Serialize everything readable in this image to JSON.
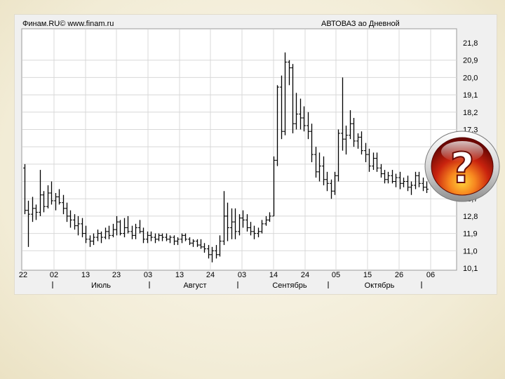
{
  "chart_data": {
    "type": "ohlc",
    "header_left": "Финам.RU© www.finam.ru",
    "title": "АВТОВАЗ ао Дневной",
    "yticks": [
      "21,8",
      "20,9",
      "20,0",
      "19,1",
      "18,2",
      "17,3",
      "16,4",
      "15,5",
      "14,6",
      "13,7",
      "12,8",
      "11,9",
      "11,0",
      "10,1"
    ],
    "ylim": [
      10.1,
      21.8
    ],
    "day_ticks": [
      "22",
      "02",
      "13",
      "23",
      "03",
      "13",
      "24",
      "03",
      "14",
      "24",
      "05",
      "15",
      "26",
      "06"
    ],
    "months": [
      "Июль",
      "Август",
      "Сентябрь",
      "Октябрь"
    ],
    "grid": true,
    "bars": [
      [
        15.3,
        15.5,
        12.9,
        13.1
      ],
      [
        13.1,
        13.6,
        11.2,
        12.9
      ],
      [
        12.9,
        13.8,
        12.5,
        13.2
      ],
      [
        13.2,
        13.4,
        12.6,
        13.0
      ],
      [
        13.0,
        15.2,
        12.8,
        13.9
      ],
      [
        13.9,
        14.1,
        13.0,
        13.3
      ],
      [
        13.3,
        14.4,
        13.2,
        14.0
      ],
      [
        14.0,
        14.6,
        13.4,
        13.6
      ],
      [
        13.6,
        14.0,
        13.1,
        13.8
      ],
      [
        13.8,
        14.2,
        13.4,
        13.5
      ],
      [
        13.5,
        13.9,
        12.9,
        13.2
      ],
      [
        13.2,
        13.5,
        12.5,
        12.8
      ],
      [
        12.8,
        13.1,
        12.2,
        12.6
      ],
      [
        12.6,
        12.9,
        12.1,
        12.3
      ],
      [
        12.3,
        12.8,
        11.8,
        12.4
      ],
      [
        12.4,
        12.7,
        11.7,
        11.9
      ],
      [
        11.9,
        12.3,
        11.4,
        11.6
      ],
      [
        11.6,
        11.8,
        11.2,
        11.5
      ],
      [
        11.5,
        11.9,
        11.3,
        11.7
      ],
      [
        11.7,
        12.1,
        11.5,
        11.9
      ],
      [
        11.9,
        12.0,
        11.4,
        11.7
      ],
      [
        11.7,
        12.2,
        11.6,
        12.0
      ],
      [
        12.0,
        12.3,
        11.6,
        11.8
      ],
      [
        11.8,
        12.4,
        11.7,
        12.1
      ],
      [
        12.1,
        12.8,
        11.8,
        12.5
      ],
      [
        12.5,
        12.6,
        11.8,
        11.9
      ],
      [
        11.9,
        12.7,
        11.7,
        12.2
      ],
      [
        12.2,
        12.8,
        11.9,
        12.0
      ],
      [
        12.0,
        12.3,
        11.6,
        11.8
      ],
      [
        11.8,
        12.4,
        11.6,
        12.2
      ],
      [
        12.2,
        12.6,
        11.9,
        12.0
      ],
      [
        12.0,
        12.2,
        11.4,
        11.6
      ],
      [
        11.6,
        12.0,
        11.4,
        11.8
      ],
      [
        11.8,
        12.0,
        11.5,
        11.7
      ],
      [
        11.7,
        11.9,
        11.4,
        11.6
      ],
      [
        11.6,
        11.9,
        11.5,
        11.8
      ],
      [
        11.8,
        11.9,
        11.5,
        11.7
      ],
      [
        11.7,
        11.9,
        11.5,
        11.6
      ],
      [
        11.6,
        11.8,
        11.4,
        11.7
      ],
      [
        11.7,
        11.8,
        11.3,
        11.5
      ],
      [
        11.5,
        11.7,
        11.3,
        11.6
      ],
      [
        11.6,
        11.9,
        11.4,
        11.8
      ],
      [
        11.8,
        11.9,
        11.5,
        11.6
      ],
      [
        11.6,
        11.7,
        11.3,
        11.4
      ],
      [
        11.4,
        11.6,
        11.2,
        11.5
      ],
      [
        11.5,
        11.6,
        11.2,
        11.3
      ],
      [
        11.3,
        11.6,
        11.1,
        11.2
      ],
      [
        11.2,
        11.4,
        10.9,
        11.1
      ],
      [
        11.1,
        11.3,
        10.6,
        10.8
      ],
      [
        10.8,
        11.2,
        10.4,
        11.0
      ],
      [
        11.0,
        11.3,
        10.6,
        10.8
      ],
      [
        10.8,
        11.8,
        10.7,
        11.5
      ],
      [
        11.5,
        14.1,
        11.3,
        12.8
      ],
      [
        12.8,
        13.5,
        11.5,
        12.2
      ],
      [
        12.2,
        13.2,
        11.6,
        12.5
      ],
      [
        12.5,
        13.2,
        11.6,
        12.0
      ],
      [
        12.0,
        12.9,
        11.8,
        12.7
      ],
      [
        12.7,
        13.1,
        12.2,
        12.6
      ],
      [
        12.6,
        12.9,
        12.0,
        12.2
      ],
      [
        12.2,
        12.5,
        11.8,
        12.0
      ],
      [
        12.0,
        12.3,
        11.6,
        11.9
      ],
      [
        11.9,
        12.2,
        11.7,
        12.0
      ],
      [
        12.0,
        12.6,
        11.9,
        12.4
      ],
      [
        12.4,
        12.8,
        12.3,
        12.6
      ],
      [
        12.6,
        13.0,
        12.5,
        12.8
      ],
      [
        12.8,
        15.9,
        12.8,
        15.7
      ],
      [
        15.7,
        19.6,
        15.4,
        19.5
      ],
      [
        19.5,
        20.1,
        16.8,
        17.2
      ],
      [
        17.2,
        21.3,
        17.0,
        20.8
      ],
      [
        20.8,
        20.9,
        19.6,
        20.5
      ],
      [
        20.5,
        20.7,
        17.1,
        17.6
      ],
      [
        17.6,
        19.2,
        17.3,
        18.1
      ],
      [
        18.1,
        18.9,
        17.3,
        17.9
      ],
      [
        17.9,
        18.5,
        17.2,
        17.5
      ],
      [
        17.5,
        18.2,
        16.8,
        17.2
      ],
      [
        17.2,
        17.6,
        15.6,
        16.0
      ],
      [
        16.0,
        16.4,
        14.8,
        15.1
      ],
      [
        15.1,
        16.1,
        14.6,
        15.4
      ],
      [
        15.4,
        15.9,
        14.4,
        14.7
      ],
      [
        14.7,
        15.1,
        14.1,
        14.5
      ],
      [
        14.5,
        14.7,
        13.7,
        14.1
      ],
      [
        14.1,
        15.1,
        13.9,
        14.9
      ],
      [
        14.9,
        17.3,
        14.6,
        17.1
      ],
      [
        17.1,
        20.0,
        16.2,
        16.8
      ],
      [
        16.8,
        17.5,
        16.0,
        17.0
      ],
      [
        17.0,
        18.3,
        16.8,
        17.6
      ],
      [
        17.6,
        17.9,
        16.4,
        16.7
      ],
      [
        16.7,
        17.1,
        16.3,
        16.9
      ],
      [
        16.9,
        17.2,
        16.0,
        16.2
      ],
      [
        16.2,
        16.6,
        15.6,
        16.0
      ],
      [
        16.0,
        16.3,
        15.1,
        15.4
      ],
      [
        15.4,
        16.1,
        15.2,
        15.8
      ],
      [
        15.8,
        16.1,
        15.1,
        15.3
      ],
      [
        15.3,
        15.5,
        14.8,
        15.0
      ],
      [
        15.0,
        15.2,
        14.5,
        14.7
      ],
      [
        14.7,
        15.1,
        14.5,
        14.9
      ],
      [
        14.9,
        15.2,
        14.5,
        14.6
      ],
      [
        14.6,
        15.0,
        14.3,
        14.8
      ],
      [
        14.8,
        15.1,
        14.2,
        14.5
      ],
      [
        14.5,
        14.8,
        14.3,
        14.6
      ],
      [
        14.6,
        14.9,
        14.1,
        14.3
      ],
      [
        14.3,
        14.6,
        13.9,
        14.4
      ],
      [
        14.4,
        15.1,
        14.2,
        14.9
      ],
      [
        14.9,
        15.1,
        14.3,
        14.5
      ],
      [
        14.5,
        14.8,
        14.1,
        14.3
      ],
      [
        14.3,
        14.6,
        14.0,
        14.2
      ]
    ]
  },
  "badge": {
    "glyph": "?"
  },
  "colors": {
    "plot_bg": "#ffffff",
    "panel_bg": "#f0f0f0",
    "grid": "#d8d8d8",
    "bars": "#000000",
    "text": "#000000"
  }
}
